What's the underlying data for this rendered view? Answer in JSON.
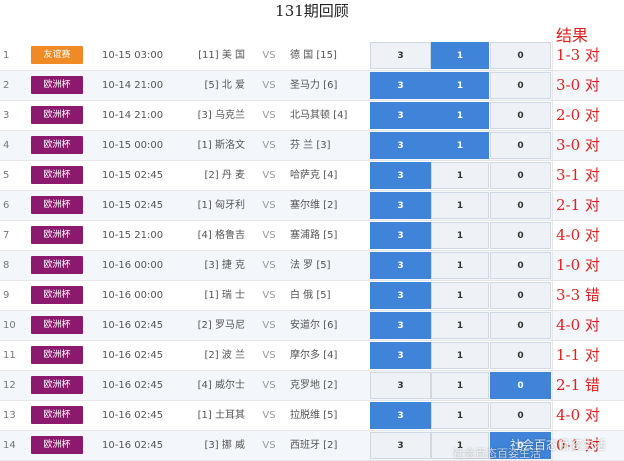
{
  "title": "131期回顾",
  "result_header": "结果",
  "vs_label": "VS",
  "colors": {
    "selected": "#3f84d8",
    "league_euro": "#8b1a6e",
    "league_friendly": "#f08a24",
    "result_text": "#e0211d"
  },
  "rows": [
    {
      "num": "1",
      "league": "友谊赛",
      "league_type": "friendly",
      "time": "10-15 03:00",
      "home": "[11] 美 国",
      "away": "德 国 [15]",
      "odds": [
        "3",
        "1",
        "0"
      ],
      "selected": [
        false,
        true,
        false
      ],
      "result": "1-3 对"
    },
    {
      "num": "2",
      "league": "欧洲杯",
      "league_type": "euro",
      "time": "10-14 21:00",
      "home": "[5] 北 爱",
      "away": "圣马力 [6]",
      "odds": [
        "3",
        "1",
        "0"
      ],
      "selected": [
        true,
        true,
        false
      ],
      "result": "3-0 对"
    },
    {
      "num": "3",
      "league": "欧洲杯",
      "league_type": "euro",
      "time": "10-14 21:00",
      "home": "[3] 乌克兰",
      "away": "北马其顿 [4]",
      "odds": [
        "3",
        "1",
        "0"
      ],
      "selected": [
        true,
        true,
        false
      ],
      "result": "2-0 对"
    },
    {
      "num": "4",
      "league": "欧洲杯",
      "league_type": "euro",
      "time": "10-15 00:00",
      "home": "[1] 斯洛文",
      "away": "芬 兰 [3]",
      "odds": [
        "3",
        "1",
        "0"
      ],
      "selected": [
        true,
        true,
        false
      ],
      "result": "3-0 对"
    },
    {
      "num": "5",
      "league": "欧洲杯",
      "league_type": "euro",
      "time": "10-15 02:45",
      "home": "[2] 丹 麦",
      "away": "哈萨克 [4]",
      "odds": [
        "3",
        "1",
        "0"
      ],
      "selected": [
        true,
        false,
        false
      ],
      "result": "3-1 对"
    },
    {
      "num": "6",
      "league": "欧洲杯",
      "league_type": "euro",
      "time": "10-15 02:45",
      "home": "[1] 匈牙利",
      "away": "塞尔维 [2]",
      "odds": [
        "3",
        "1",
        "0"
      ],
      "selected": [
        true,
        false,
        false
      ],
      "result": "2-1 对"
    },
    {
      "num": "7",
      "league": "欧洲杯",
      "league_type": "euro",
      "time": "10-15 21:00",
      "home": "[4] 格鲁吉",
      "away": "塞浦路 [5]",
      "odds": [
        "3",
        "1",
        "0"
      ],
      "selected": [
        true,
        false,
        false
      ],
      "result": "4-0 对"
    },
    {
      "num": "8",
      "league": "欧洲杯",
      "league_type": "euro",
      "time": "10-16 00:00",
      "home": "[3] 捷 克",
      "away": "法 罗 [5]",
      "odds": [
        "3",
        "1",
        "0"
      ],
      "selected": [
        true,
        false,
        false
      ],
      "result": "1-0 对"
    },
    {
      "num": "9",
      "league": "欧洲杯",
      "league_type": "euro",
      "time": "10-16 00:00",
      "home": "[1] 瑞 士",
      "away": "白 俄 [5]",
      "odds": [
        "3",
        "1",
        "0"
      ],
      "selected": [
        true,
        false,
        false
      ],
      "result": "3-3 错"
    },
    {
      "num": "10",
      "league": "欧洲杯",
      "league_type": "euro",
      "time": "10-16 02:45",
      "home": "[2] 罗马尼",
      "away": "安道尔 [6]",
      "odds": [
        "3",
        "1",
        "0"
      ],
      "selected": [
        true,
        false,
        false
      ],
      "result": "4-0 对"
    },
    {
      "num": "11",
      "league": "欧洲杯",
      "league_type": "euro",
      "time": "10-16 02:45",
      "home": "[2] 波 兰",
      "away": "摩尔多 [4]",
      "odds": [
        "3",
        "1",
        "0"
      ],
      "selected": [
        true,
        false,
        false
      ],
      "result": "1-1 对"
    },
    {
      "num": "12",
      "league": "欧洲杯",
      "league_type": "euro",
      "time": "10-16 02:45",
      "home": "[4] 威尔士",
      "away": "克罗地 [2]",
      "odds": [
        "3",
        "1",
        "0"
      ],
      "selected": [
        false,
        false,
        true
      ],
      "result": "2-1 错"
    },
    {
      "num": "13",
      "league": "欧洲杯",
      "league_type": "euro",
      "time": "10-16 02:45",
      "home": "[1] 土耳其",
      "away": "拉脱维 [5]",
      "odds": [
        "3",
        "1",
        "0"
      ],
      "selected": [
        true,
        false,
        false
      ],
      "result": "4-0 对"
    },
    {
      "num": "14",
      "league": "欧洲杯",
      "league_type": "euro",
      "time": "10-16 02:45",
      "home": "[3] 挪 威",
      "away": "西班牙 [2]",
      "odds": [
        "3",
        "1",
        "0"
      ],
      "selected": [
        false,
        false,
        true
      ],
      "result": "0-1 对"
    }
  ],
  "watermark": "社会百态百姿生活",
  "watermark2": "社会百态百姿生活"
}
